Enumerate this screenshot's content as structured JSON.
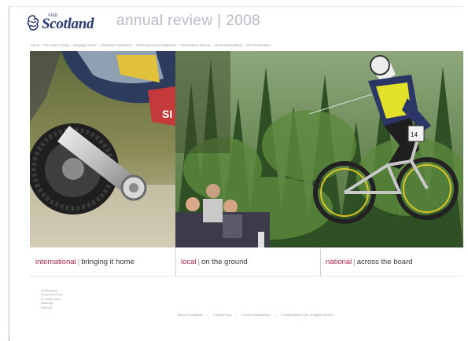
{
  "header": {
    "logo_small": "visit",
    "logo_text": "Scotland",
    "title": "annual review | 2008"
  },
  "nav": {
    "items": [
      "Home",
      "The Year's Activity",
      "Bringing it home",
      "Chairman's Statement",
      "Chief Executive's Statement",
      "Performance Review",
      "About VisitScotland",
      "Our Performance"
    ]
  },
  "captions": [
    {
      "key": "international",
      "desc": "bringing it home"
    },
    {
      "key": "local",
      "desc": "on the ground"
    },
    {
      "key": "national",
      "desc": "across the board"
    }
  ],
  "footer": {
    "address_lines": [
      "VisitScotland",
      "Ocean Point One",
      "94 Ocean Drive",
      "Edinburgh",
      "EH6 6JH"
    ],
    "links": [
      "Terms & Conditions",
      "Privacy Policy",
      "Contact VisitScotland",
      "© VisitScotland 2008. All rights reserved."
    ]
  },
  "colors": {
    "brand_navy": "#2b3b74",
    "accent_red": "#b0274e",
    "title_grey": "#b9bbc6"
  }
}
